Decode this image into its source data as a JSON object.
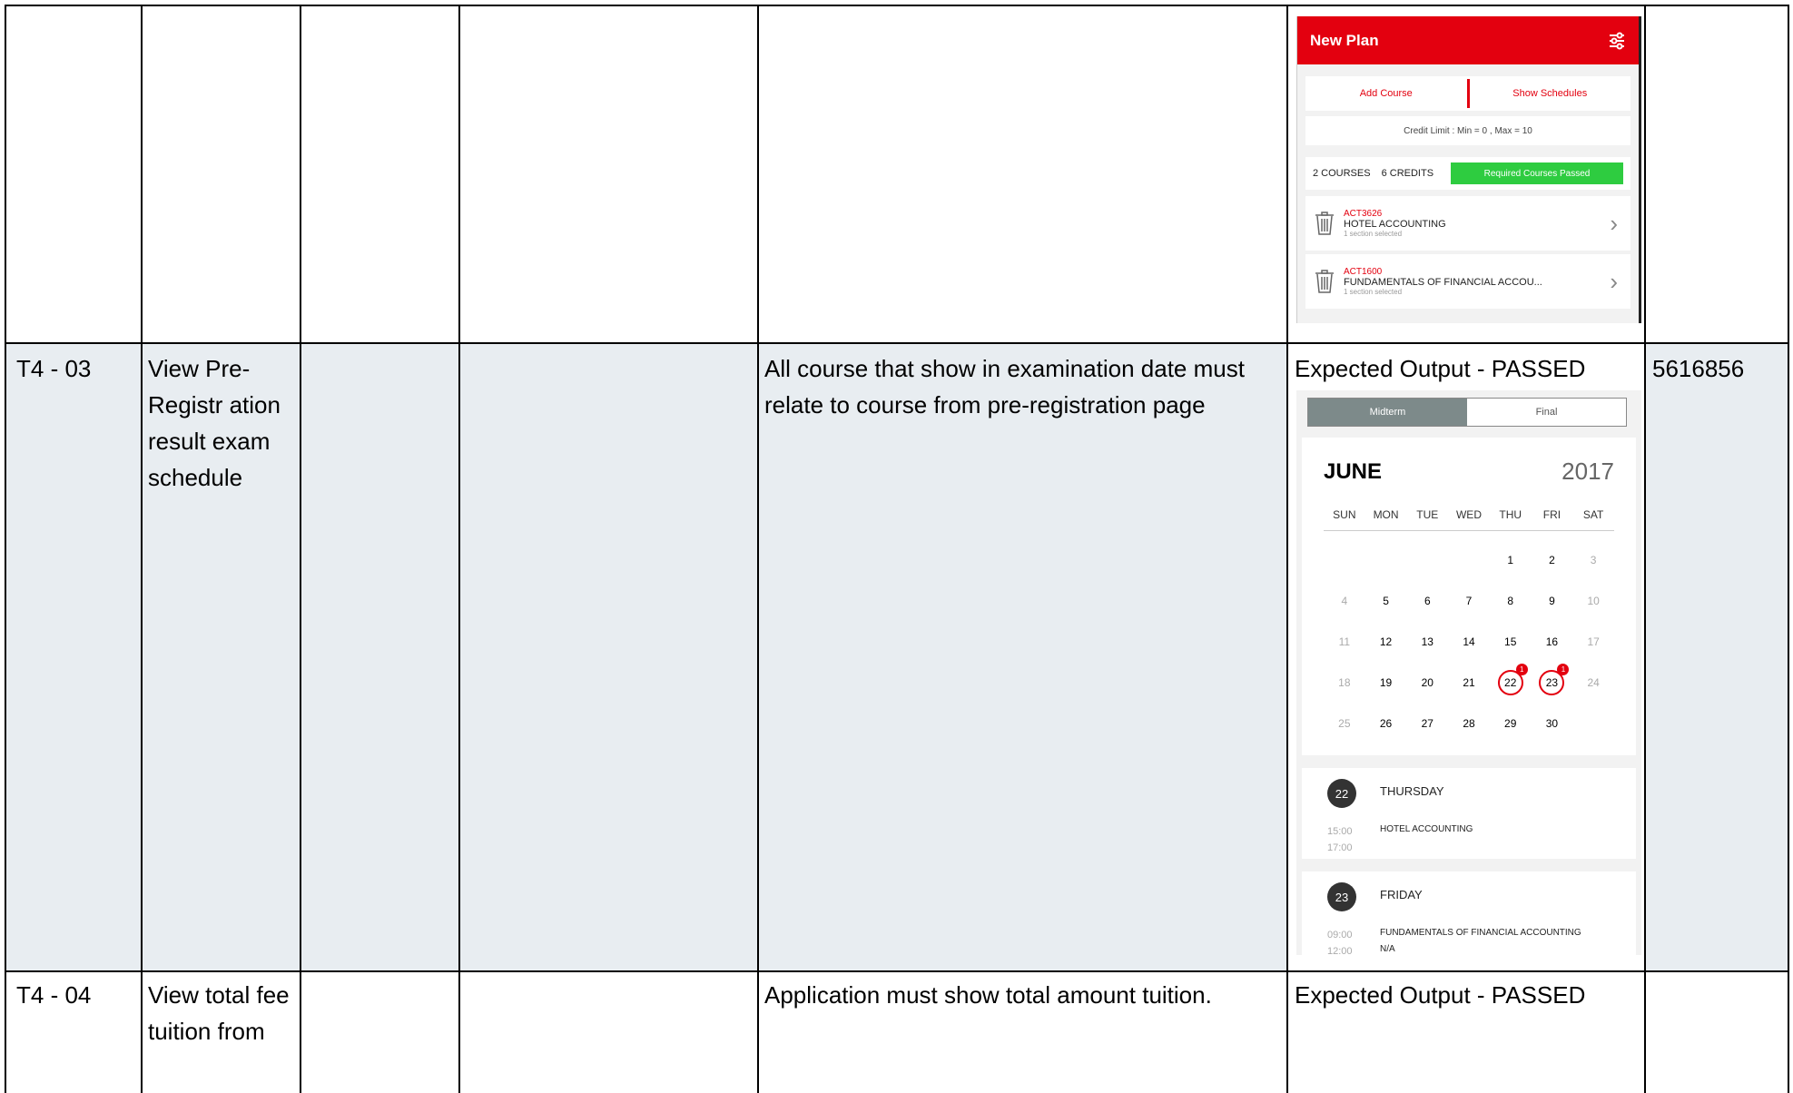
{
  "rows": [
    {
      "id": "",
      "name": "",
      "expected": "",
      "result": "",
      "user": ""
    },
    {
      "id": "T4 - 03",
      "name": "View Pre-Registr ation result exam schedule",
      "expected": "All course that show in examination date must relate to course from pre-registration page",
      "result": "Expected Output - PASSED",
      "user": "5616856"
    },
    {
      "id": "T4 - 04",
      "name": "View total fee tuition from",
      "expected": "Application must show total amount tuition.",
      "result": "Expected Output - PASSED",
      "user": ""
    }
  ],
  "plan_screen": {
    "title": "New Plan",
    "add_course": "Add Course",
    "show_schedules": "Show Schedules",
    "credit_limit": "Credit Limit : Min = 0 , Max = 10",
    "courses_count": "2 COURSES",
    "credits_count": "6 CREDITS",
    "status_badge": "Required Courses Passed",
    "courses": [
      {
        "code": "ACT3626",
        "name": "HOTEL ACCOUNTING",
        "sub": "1 section selected"
      },
      {
        "code": "ACT1600",
        "name": "FUNDAMENTALS OF FINANCIAL ACCOU...",
        "sub": "1 section selected"
      }
    ]
  },
  "exam_screen": {
    "tab_midterm": "Midterm",
    "tab_final": "Final",
    "month": "JUNE",
    "year": "2017",
    "weekdays": [
      "SUN",
      "MON",
      "TUE",
      "WED",
      "THU",
      "FRI",
      "SAT"
    ],
    "exam_badge": "1",
    "events": [
      {
        "num": "22",
        "day": "THURSDAY",
        "start": "15:00",
        "end": "17:00",
        "course": "HOTEL ACCOUNTING",
        "extra": ""
      },
      {
        "num": "23",
        "day": "FRIDAY",
        "start": "09:00",
        "end": "12:00",
        "course": "FUNDAMENTALS OF FINANCIAL ACCOUNTING",
        "extra": "N/A"
      }
    ]
  },
  "colors": {
    "brand_red": "#e3000f",
    "badge_green": "#2ecc40",
    "row_shade": "#e8edf1"
  }
}
